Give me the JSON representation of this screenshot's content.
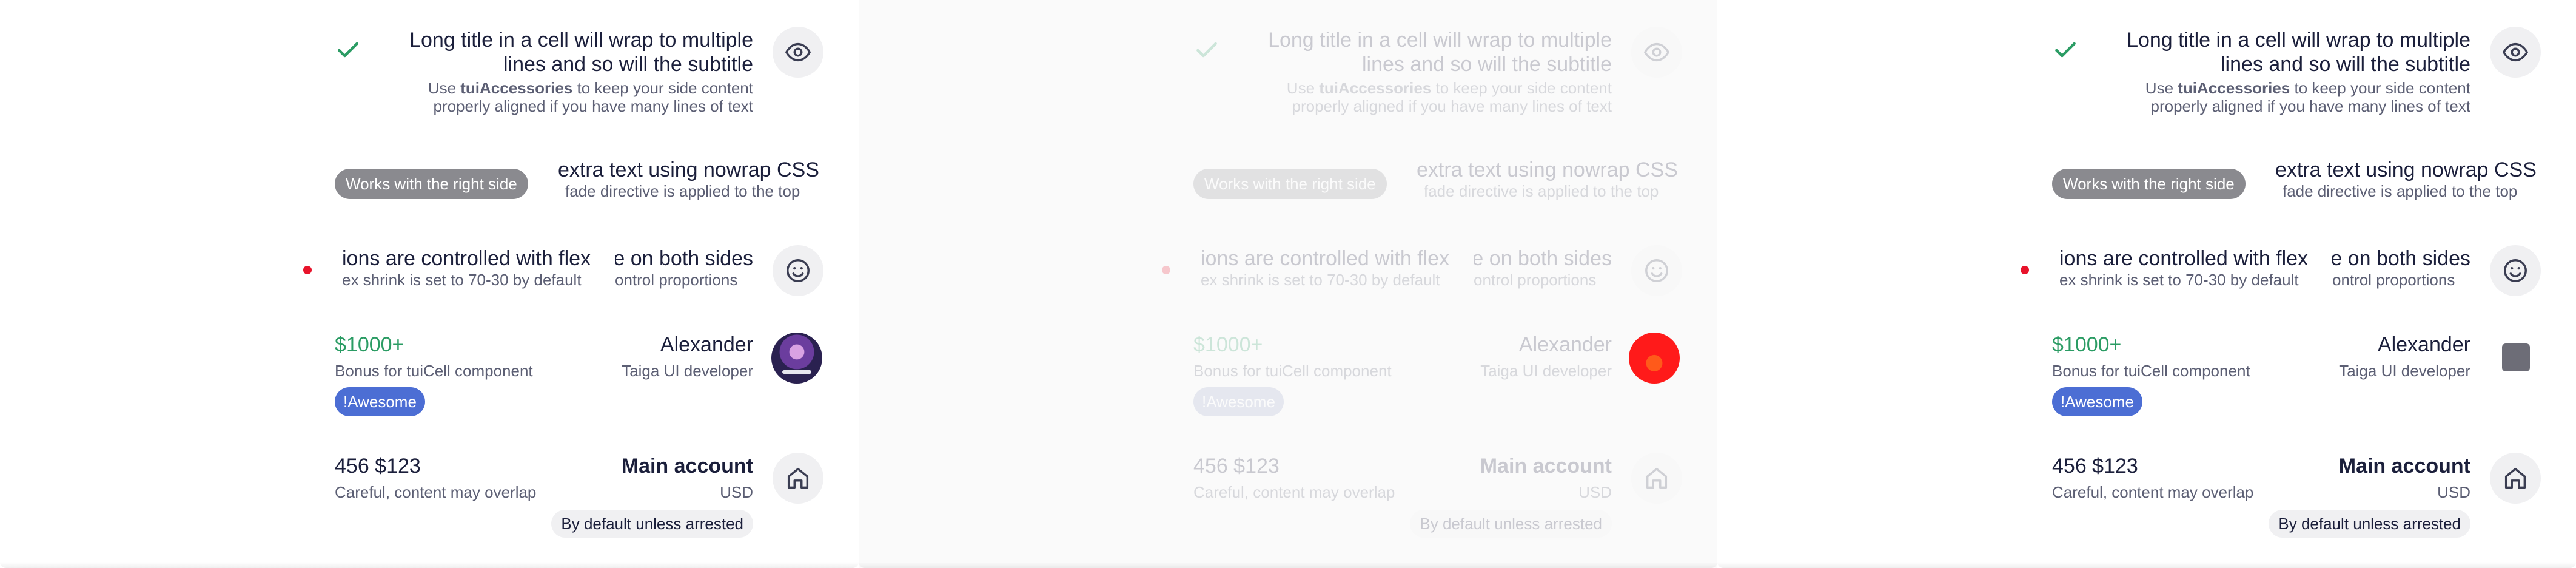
{
  "cell1": {
    "title": "Long title in a cell will wrap to multiple lines and so will the subtitle",
    "subtitle_pre": "Use ",
    "subtitle_bold": "tuiAccessories",
    "subtitle_post": " to keep your side content properly aligned if you have many lines of text",
    "left_icon": "check-icon",
    "right_icon": "eye-icon"
  },
  "cell2": {
    "chip": "Works with the right side",
    "title": "extra text using nowrap CSS",
    "subtitle": "fade directive is applied to the top"
  },
  "cell3": {
    "left_title": "ions are controlled with flex",
    "left_subtitle": "ex shrink is set to 70-30 by default",
    "right_title": "e on both sides",
    "right_subtitle": "ontrol proportions",
    "right_icon": "smile-icon"
  },
  "cell4": {
    "price": "$1000+",
    "subtitle": "Bonus for tuiCell component",
    "chip": "!Awesome",
    "name": "Alexander",
    "role": "Taiga UI developer"
  },
  "cell5": {
    "amount": "456 $123",
    "warning": "Careful, content may overlap",
    "account": "Main account",
    "currency": "USD",
    "chip": "By default unless arrested",
    "right_icon": "home-icon"
  },
  "colors": {
    "accent_green": "#2b9c64",
    "chip_blue": "#4c6ed4",
    "chip_gray": "#8a8a8f",
    "indicator_red": "#e8132b"
  }
}
